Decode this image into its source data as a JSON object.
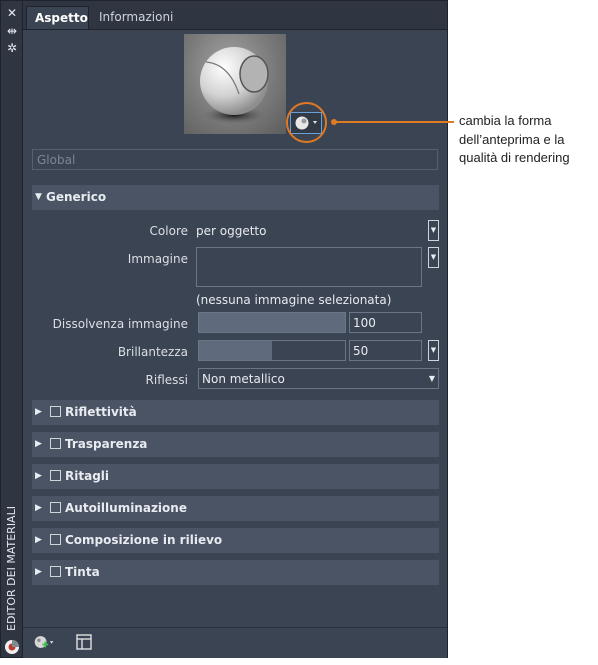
{
  "window": {
    "vertical_title": "EDITOR DEI MATERIALI",
    "controls": [
      {
        "name": "close-icon",
        "glyph": "✕"
      },
      {
        "name": "pin-icon",
        "glyph": "⇹"
      },
      {
        "name": "settings-icon",
        "glyph": "✲"
      }
    ]
  },
  "tabs": [
    {
      "label": "Aspetto",
      "active": true
    },
    {
      "label": "Informazioni",
      "active": false
    }
  ],
  "material_name": {
    "placeholder": "Global"
  },
  "callout": {
    "lines": [
      "cambia la forma",
      "dell’anteprima e la",
      "qualità di rendering"
    ],
    "color": "#e07a22"
  },
  "generic_section": {
    "title": "Generico",
    "color": {
      "label": "Colore",
      "value": "per oggetto"
    },
    "image": {
      "label": "Immagine",
      "note": "(nessuna immagine selezionata)"
    },
    "image_fade": {
      "label": "Dissolvenza immagine",
      "value": "100",
      "fraction": 1.0
    },
    "glossiness": {
      "label": "Brillantezza",
      "value": "50",
      "fraction": 0.5
    },
    "highlights": {
      "label": "Riflessi",
      "value": "Non metallico"
    }
  },
  "sections": [
    {
      "label": "Riflettività",
      "checked": false
    },
    {
      "label": "Trasparenza",
      "checked": false
    },
    {
      "label": "Ritagli",
      "checked": false
    },
    {
      "label": "Autoilluminazione",
      "checked": false
    },
    {
      "label": "Composizione in rilievo",
      "checked": false
    },
    {
      "label": "Tinta",
      "checked": false
    }
  ],
  "bottom_toolbar": {
    "buttons": [
      {
        "name": "create-material-icon"
      },
      {
        "name": "material-browser-icon"
      }
    ]
  }
}
